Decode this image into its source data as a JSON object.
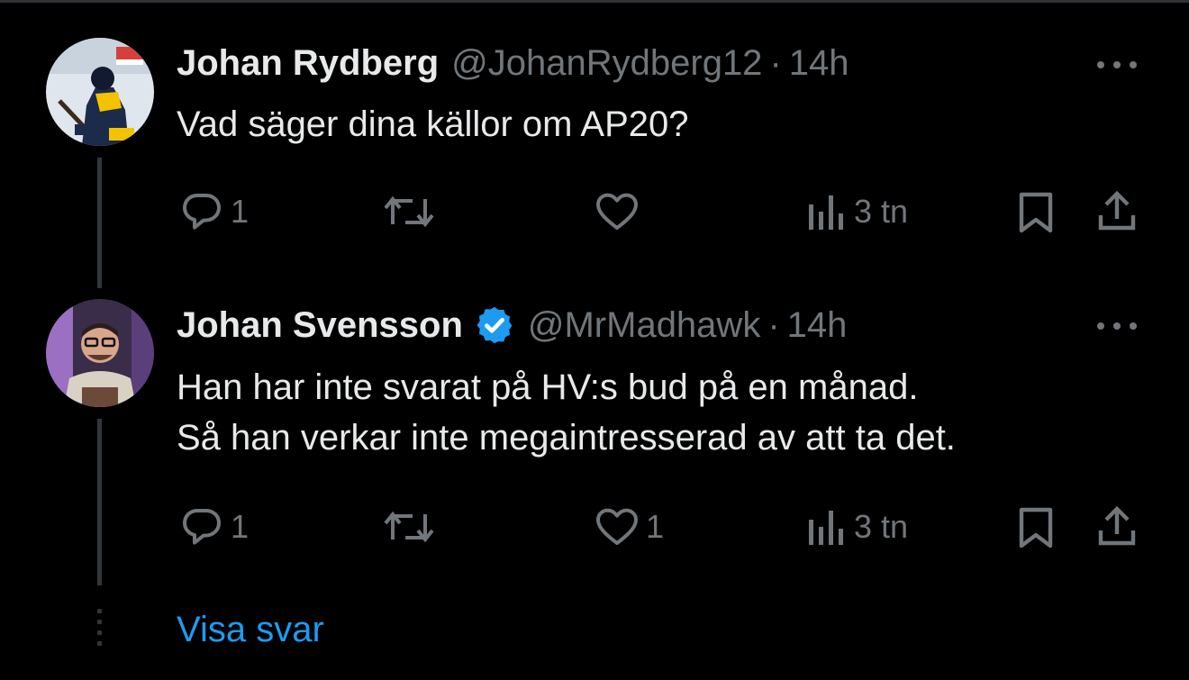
{
  "tweets": [
    {
      "name": "Johan Rydberg",
      "handle": "@JohanRydberg12",
      "separator": "·",
      "time": "14h",
      "text_lines": [
        "Vad säger dina källor om AP20?"
      ],
      "actions": {
        "reply_count": "1",
        "retweet_count": "",
        "like_count": "",
        "views_count": "3 tn"
      },
      "avatar_icon": "hockey-player-avatar",
      "verified": false
    },
    {
      "name": "Johan Svensson",
      "handle": "@MrMadhawk",
      "separator": "·",
      "time": "14h",
      "text_lines": [
        "Han har inte svarat på HV:s bud på en månad.",
        "Så han verkar inte megaintresserad av att ta det."
      ],
      "actions": {
        "reply_count": "1",
        "retweet_count": "",
        "like_count": "1",
        "views_count": "3 tn"
      },
      "avatar_icon": "man-with-glasses-avatar",
      "verified": true
    }
  ],
  "show_replies_label": "Visa svar",
  "colors": {
    "background": "#000000",
    "text_primary": "#e7e9ea",
    "text_secondary": "#71767b",
    "link": "#1d9bf0",
    "verified": "#1d9bf0",
    "thread_line": "#333639"
  },
  "icons": [
    "reply-icon",
    "retweet-icon",
    "like-icon",
    "views-icon",
    "bookmark-icon",
    "share-icon",
    "more-icon",
    "verified-badge-icon"
  ]
}
